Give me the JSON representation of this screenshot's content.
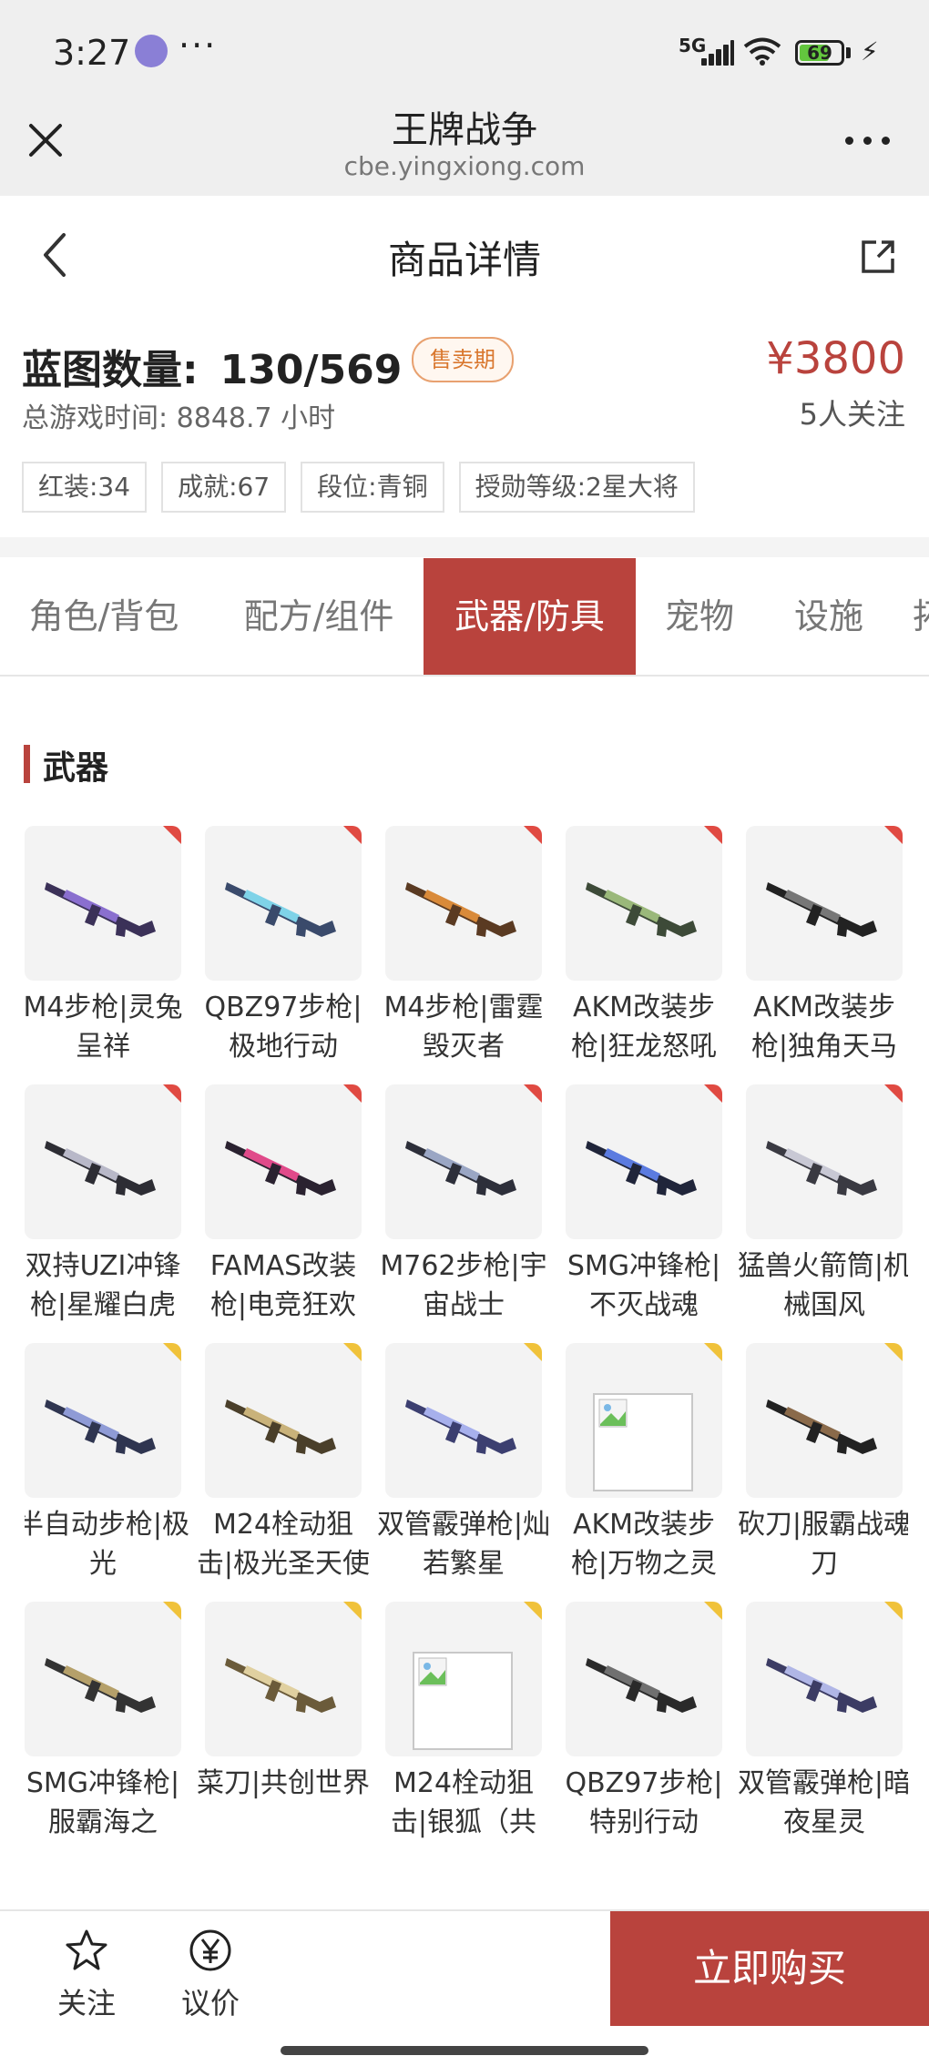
{
  "status_bar": {
    "time": "3:27",
    "more": "···",
    "network": "5G",
    "battery": "69",
    "battery_level": 0.69
  },
  "browser": {
    "title": "王牌战争",
    "url": "cbe.yingxiong.com"
  },
  "nav": {
    "title": "商品详情"
  },
  "summary": {
    "blueprint_label": "蓝图数量:",
    "blueprint_value": "130/569",
    "sale_status": "售卖期",
    "price": "¥3800",
    "playtime": "总游戏时间: 8848.7 小时",
    "followers": "5人关注",
    "tags": [
      "红装:34",
      "成就:67",
      "段位:青铜",
      "授勋等级:2星大将"
    ]
  },
  "tabs": [
    {
      "label": "角色/背包",
      "active": false
    },
    {
      "label": "配方/组件",
      "active": false
    },
    {
      "label": "武器/防具",
      "active": true
    },
    {
      "label": "宠物",
      "active": false
    },
    {
      "label": "设施",
      "active": false
    },
    {
      "label": "拓",
      "active": false
    }
  ],
  "section": {
    "title": "武器"
  },
  "items": [
    {
      "name": "M4步枪|灵兔呈祥",
      "rarity": "red"
    },
    {
      "name": "QBZ97步枪|极地行动",
      "rarity": "red"
    },
    {
      "name": "M4步枪|雷霆毁灭者",
      "rarity": "red"
    },
    {
      "name": "AKM改装步枪|狂龙怒吼",
      "rarity": "red"
    },
    {
      "name": "AKM改装步枪|独角天马",
      "rarity": "red"
    },
    {
      "name": "双持UZI冲锋枪|星耀白虎",
      "rarity": "red"
    },
    {
      "name": "FAMAS改装枪|电竞狂欢",
      "rarity": "red"
    },
    {
      "name": "M762步枪|宇宙战士",
      "rarity": "red"
    },
    {
      "name": "SMG冲锋枪|不灭战魂",
      "rarity": "red"
    },
    {
      "name": "猛兽火箭筒|机械国风",
      "rarity": "red"
    },
    {
      "name": "半自动步枪|极光",
      "rarity": "gold"
    },
    {
      "name": "M24栓动狙击|极光圣天使",
      "rarity": "gold"
    },
    {
      "name": "双管霰弹枪|灿若繁星",
      "rarity": "gold"
    },
    {
      "name": "AKM改装步枪|万物之灵",
      "rarity": "gold"
    },
    {
      "name": "砍刀|服霸战魂刀",
      "rarity": "gold"
    },
    {
      "name": "SMG冲锋枪|服霸海之",
      "rarity": "gold"
    },
    {
      "name": "菜刀|共创世界",
      "rarity": "gold"
    },
    {
      "name": "M24栓动狙击|银狐（共",
      "rarity": "gold"
    },
    {
      "name": "QBZ97步枪|特别行动",
      "rarity": "gold"
    },
    {
      "name": "双管霰弹枪|暗夜星灵",
      "rarity": "gold"
    }
  ],
  "bottom": {
    "follow": "关注",
    "bargain": "议价",
    "buy": "立即购买"
  },
  "colors": {
    "accent": "#b9433d",
    "badge": "#d9772e",
    "rarity_red": "#e04a42",
    "rarity_gold": "#f0c23a"
  },
  "icons": [
    "close-icon",
    "more-icon",
    "back-icon",
    "share-icon",
    "star-icon",
    "yen-icon"
  ]
}
